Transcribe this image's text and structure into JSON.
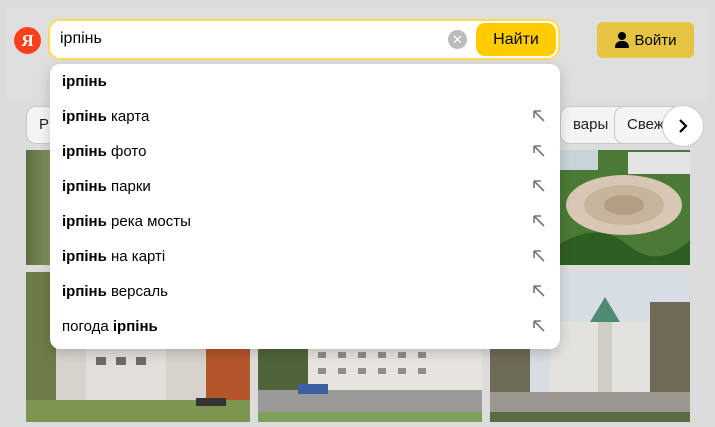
{
  "header": {
    "logo_letter": "Я",
    "search": {
      "value": "ірпінь"
    },
    "find_label": "Найти",
    "login_label": "Войти"
  },
  "chips": [
    "Р",
    "вары",
    "Свеж"
  ],
  "suggestions": [
    {
      "bold": "ірпінь",
      "rest": ""
    },
    {
      "bold": "ірпінь",
      "rest": " карта"
    },
    {
      "bold": "ірпінь",
      "rest": " фото"
    },
    {
      "bold": "ірпінь",
      "rest": " парки"
    },
    {
      "bold": "ірпінь",
      "rest": " река мосты"
    },
    {
      "bold": "ірпінь",
      "rest": " на карті"
    },
    {
      "bold": "ірпінь",
      "rest": " версаль"
    },
    {
      "prefix": "погода ",
      "bold": "ірпінь"
    }
  ],
  "icons": {
    "clear": "clear-icon",
    "arrow": "arrow-up-left-icon",
    "next": "chevron-right-icon",
    "user": "user-icon"
  },
  "colors": {
    "brand_red": "#fc3f1d",
    "find_yellow": "#ffcc00",
    "login_yellow": "#e6c443"
  }
}
